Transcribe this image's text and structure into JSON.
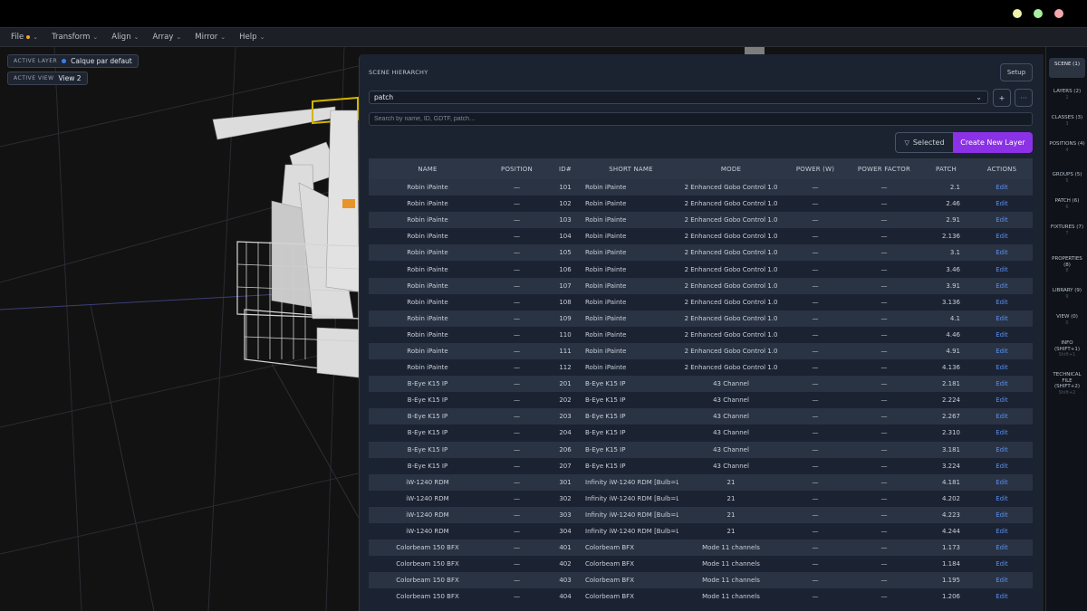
{
  "window": {
    "buttons": [
      {
        "name": "minimize",
        "color": "#f1f3a8"
      },
      {
        "name": "maximize",
        "color": "#a8f0a1"
      },
      {
        "name": "close",
        "color": "#f2a9ae"
      }
    ]
  },
  "menu": [
    {
      "label": "File"
    },
    {
      "label": "Transform"
    },
    {
      "label": "Align"
    },
    {
      "label": "Array"
    },
    {
      "label": "Mirror"
    },
    {
      "label": "Help"
    }
  ],
  "viewport": {
    "active_layer_label": "ACTIVE LAYER",
    "active_layer_value": "Calque par defaut",
    "active_view_label": "ACTIVE VIEW",
    "active_view_value": "View 2"
  },
  "panel": {
    "title": "SCENE HIERARCHY",
    "setup_label": "Setup",
    "select_value": "patch",
    "add_label": "+",
    "more_label": "···",
    "search_placeholder": "Search by name, ID, GDTF, patch…",
    "selected_label": "Selected",
    "create_label": "Create New Layer",
    "columns": [
      "NAME",
      "POSITION",
      "ID#",
      "SHORT NAME",
      "MODE",
      "POWER (W)",
      "POWER FACTOR",
      "PATCH",
      "ACTIONS"
    ],
    "edit_label": "Edit",
    "dash": "—",
    "rows": [
      {
        "name": "Robin iPainte",
        "id": "101",
        "short": "Robin iPainte",
        "mode": "2 Enhanced Gobo Control 1.0",
        "patch": "2.1"
      },
      {
        "name": "Robin iPainte",
        "id": "102",
        "short": "Robin iPainte",
        "mode": "2 Enhanced Gobo Control 1.0",
        "patch": "2.46"
      },
      {
        "name": "Robin iPainte",
        "id": "103",
        "short": "Robin iPainte",
        "mode": "2 Enhanced Gobo Control 1.0",
        "patch": "2.91"
      },
      {
        "name": "Robin iPainte",
        "id": "104",
        "short": "Robin iPainte",
        "mode": "2 Enhanced Gobo Control 1.0",
        "patch": "2.136"
      },
      {
        "name": "Robin iPainte",
        "id": "105",
        "short": "Robin iPainte",
        "mode": "2 Enhanced Gobo Control 1.0",
        "patch": "3.1"
      },
      {
        "name": "Robin iPainte",
        "id": "106",
        "short": "Robin iPainte",
        "mode": "2 Enhanced Gobo Control 1.0",
        "patch": "3.46"
      },
      {
        "name": "Robin iPainte",
        "id": "107",
        "short": "Robin iPainte",
        "mode": "2 Enhanced Gobo Control 1.0",
        "patch": "3.91"
      },
      {
        "name": "Robin iPainte",
        "id": "108",
        "short": "Robin iPainte",
        "mode": "2 Enhanced Gobo Control 1.0",
        "patch": "3.136"
      },
      {
        "name": "Robin iPainte",
        "id": "109",
        "short": "Robin iPainte",
        "mode": "2 Enhanced Gobo Control 1.0",
        "patch": "4.1"
      },
      {
        "name": "Robin iPainte",
        "id": "110",
        "short": "Robin iPainte",
        "mode": "2 Enhanced Gobo Control 1.0",
        "patch": "4.46"
      },
      {
        "name": "Robin iPainte",
        "id": "111",
        "short": "Robin iPainte",
        "mode": "2 Enhanced Gobo Control 1.0",
        "patch": "4.91"
      },
      {
        "name": "Robin iPainte",
        "id": "112",
        "short": "Robin iPainte",
        "mode": "2 Enhanced Gobo Control 1.0",
        "patch": "4.136"
      },
      {
        "name": "B-Eye K15 IP",
        "id": "201",
        "short": "B-Eye K15 IP",
        "mode": "43 Channel",
        "patch": "2.181"
      },
      {
        "name": "B-Eye K15 IP",
        "id": "202",
        "short": "B-Eye K15 IP",
        "mode": "43 Channel",
        "patch": "2.224"
      },
      {
        "name": "B-Eye K15 IP",
        "id": "203",
        "short": "B-Eye K15 IP",
        "mode": "43 Channel",
        "patch": "2.267"
      },
      {
        "name": "B-Eye K15 IP",
        "id": "204",
        "short": "B-Eye K15 IP",
        "mode": "43 Channel",
        "patch": "2.310"
      },
      {
        "name": "B-Eye K15 IP",
        "id": "206",
        "short": "B-Eye K15 IP",
        "mode": "43 Channel",
        "patch": "3.181"
      },
      {
        "name": "B-Eye K15 IP",
        "id": "207",
        "short": "B-Eye K15 IP",
        "mode": "43 Channel",
        "patch": "3.224"
      },
      {
        "name": "iW-1240 RDM",
        "id": "301",
        "short": "Infinity iW-1240 RDM [Bulb=LED]",
        "mode": "21",
        "patch": "4.181"
      },
      {
        "name": "iW-1240 RDM",
        "id": "302",
        "short": "Infinity iW-1240 RDM [Bulb=LED]",
        "mode": "21",
        "patch": "4.202"
      },
      {
        "name": "iW-1240 RDM",
        "id": "303",
        "short": "Infinity iW-1240 RDM [Bulb=LED]",
        "mode": "21",
        "patch": "4.223"
      },
      {
        "name": "iW-1240 RDM",
        "id": "304",
        "short": "Infinity iW-1240 RDM [Bulb=LED]",
        "mode": "21",
        "patch": "4.244"
      },
      {
        "name": "Colorbeam 150 BFX",
        "id": "401",
        "short": "Colorbeam BFX",
        "mode": "Mode 11 channels",
        "patch": "1.173"
      },
      {
        "name": "Colorbeam 150 BFX",
        "id": "402",
        "short": "Colorbeam BFX",
        "mode": "Mode 11 channels",
        "patch": "1.184"
      },
      {
        "name": "Colorbeam 150 BFX",
        "id": "403",
        "short": "Colorbeam BFX",
        "mode": "Mode 11 channels",
        "patch": "1.195"
      },
      {
        "name": "Colorbeam 150 BFX",
        "id": "404",
        "short": "Colorbeam BFX",
        "mode": "Mode 11 channels",
        "patch": "1.206"
      }
    ]
  },
  "sidebar": [
    {
      "label": "SCENE (1)",
      "sub": "",
      "active": true
    },
    {
      "label": "LAYERS (2)",
      "sub": "2",
      "active": false
    },
    {
      "label": "CLASSES (3)",
      "sub": "3",
      "active": false
    },
    {
      "label": "POSITIONS (4)",
      "sub": "4",
      "active": false
    },
    {
      "label": "GROUPS (5)",
      "sub": "5",
      "active": false
    },
    {
      "label": "PATCH (6)",
      "sub": "6",
      "active": false
    },
    {
      "label": "FIXTURES (7)",
      "sub": "7",
      "active": false
    },
    {
      "label": "PROPERTIES (8)",
      "sub": "8",
      "active": false
    },
    {
      "label": "LIBRARY (9)",
      "sub": "9",
      "active": false
    },
    {
      "label": "VIEW (0)",
      "sub": "0",
      "active": false
    },
    {
      "label": "INFO (SHIFT+1)",
      "sub": "Shift+1",
      "active": false
    },
    {
      "label": "TECHNICAL FILE (SHIFT+2)",
      "sub": "Shift+2",
      "active": false
    }
  ]
}
